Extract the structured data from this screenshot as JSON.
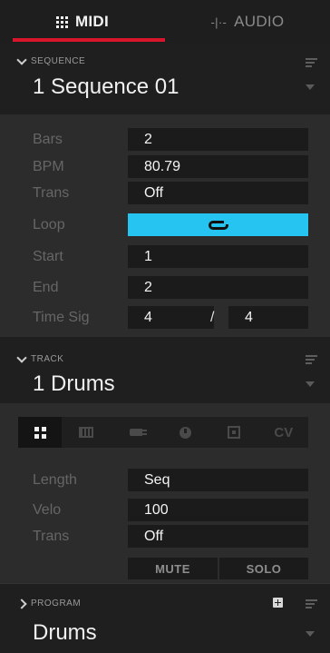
{
  "tabs": [
    {
      "label": "MIDI",
      "icon": "grid-icon",
      "active": true
    },
    {
      "label": "AUDIO",
      "icon": "waveform-icon",
      "active": false
    }
  ],
  "sequence": {
    "header_label": "SEQUENCE",
    "name": "1 Sequence 01",
    "fields": {
      "bars": {
        "label": "Bars",
        "value": "2"
      },
      "bpm": {
        "label": "BPM",
        "value": "80.79"
      },
      "trans": {
        "label": "Trans",
        "value": "Off"
      },
      "loop": {
        "label": "Loop",
        "icon": "loop-icon",
        "enabled": true
      },
      "start": {
        "label": "Start",
        "value": "1"
      },
      "end": {
        "label": "End",
        "value": "2"
      },
      "time_sig": {
        "label": "Time Sig",
        "numerator": "4",
        "separator": "/",
        "denominator": "4"
      }
    }
  },
  "track": {
    "header_label": "TRACK",
    "name": "1 Drums",
    "tool_icons": [
      "pads-grid-icon",
      "keyboard-icon",
      "plugin-icon",
      "knob-icon",
      "box-icon",
      "CV"
    ],
    "fields": {
      "length": {
        "label": "Length",
        "value": "Seq"
      },
      "velo": {
        "label": "Velo",
        "value": "100"
      },
      "trans": {
        "label": "Trans",
        "value": "Off"
      }
    },
    "buttons": {
      "mute": "MUTE",
      "solo": "SOLO"
    }
  },
  "program": {
    "header_label": "PROGRAM",
    "name": "Drums"
  },
  "colors": {
    "accent_red": "#d8162b",
    "loop_active": "#26c4f0",
    "background": "#2a2a2a"
  }
}
